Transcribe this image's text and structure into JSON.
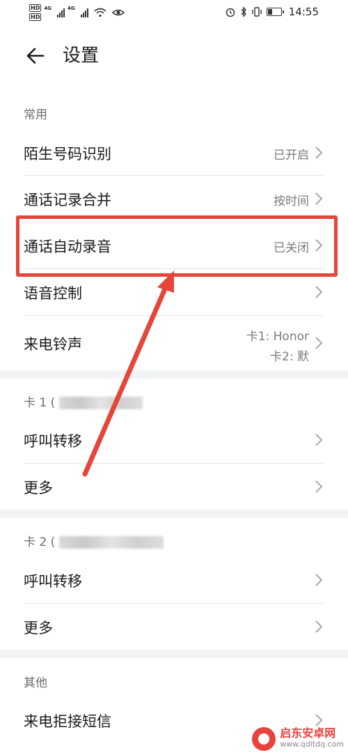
{
  "status": {
    "time": "14:55",
    "network_tag": "4G",
    "hd_label": "HD"
  },
  "header": {
    "title": "设置"
  },
  "sections": {
    "common": {
      "label": "常用",
      "rows": [
        {
          "label": "陌生号码识别",
          "value": "已开启"
        },
        {
          "label": "通话记录合并",
          "value": "按时间"
        },
        {
          "label": "通话自动录音",
          "value": "已关闭"
        },
        {
          "label": "语音控制",
          "value": ""
        },
        {
          "label": "来电铃声",
          "value_line1": "卡1: Honor",
          "value_line2": "卡2: 默"
        }
      ]
    },
    "card1": {
      "label": "卡 1 (",
      "rows": [
        {
          "label": "呼叫转移"
        },
        {
          "label": "更多"
        }
      ]
    },
    "card2": {
      "label": "卡 2 (",
      "rows": [
        {
          "label": "呼叫转移"
        },
        {
          "label": "更多"
        }
      ]
    },
    "other": {
      "label": "其他",
      "rows": [
        {
          "label": "来电拒接短信"
        }
      ]
    }
  },
  "annotation": {
    "color": "#e6453a"
  },
  "watermark": {
    "title": "启东安卓网",
    "url": "www.qdltdq.com"
  }
}
